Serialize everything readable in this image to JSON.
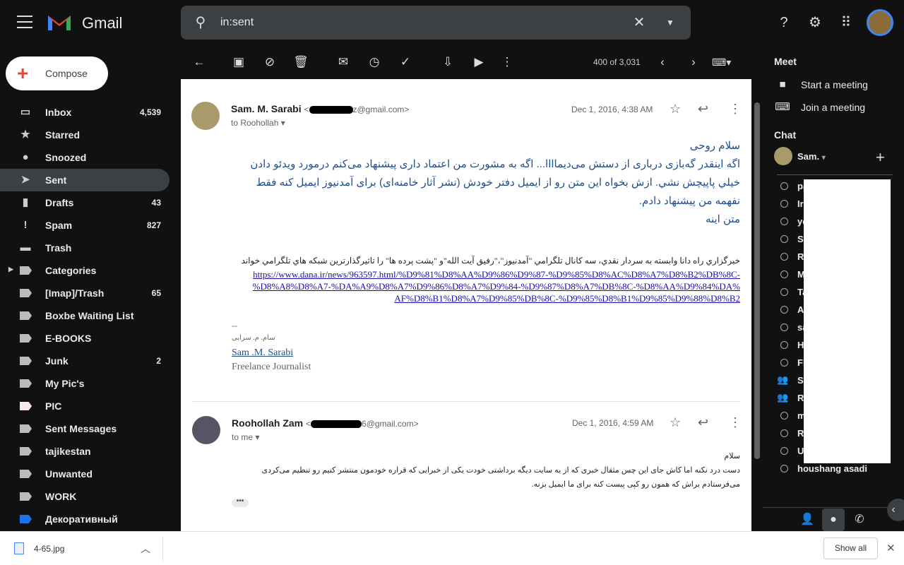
{
  "app": {
    "name": "Gmail"
  },
  "search": {
    "query": "in:sent"
  },
  "compose_label": "Compose",
  "nav": [
    {
      "label": "Inbox",
      "count": "4,539",
      "icon": "inbox-icon"
    },
    {
      "label": "Starred",
      "count": "",
      "icon": "star-icon"
    },
    {
      "label": "Snoozed",
      "count": "",
      "icon": "clock-icon"
    },
    {
      "label": "Sent",
      "count": "",
      "icon": "send-icon",
      "selected": true
    },
    {
      "label": "Drafts",
      "count": "43",
      "icon": "draft-icon"
    },
    {
      "label": "Spam",
      "count": "827",
      "icon": "spam-icon"
    },
    {
      "label": "Trash",
      "count": "",
      "icon": "trash-icon"
    },
    {
      "label": "Categories",
      "count": "",
      "icon": "label-icon"
    },
    {
      "label": "[Imap]/Trash",
      "count": "65",
      "icon": "label-icon"
    },
    {
      "label": "Boxbe Waiting List",
      "count": "",
      "icon": "label-icon"
    },
    {
      "label": "E-BOOKS",
      "count": "",
      "icon": "label-icon"
    },
    {
      "label": "Junk",
      "count": "2",
      "icon": "label-icon"
    },
    {
      "label": "My Pic's",
      "count": "",
      "icon": "label-icon"
    },
    {
      "label": "PIC",
      "count": "",
      "icon": "label-icon",
      "color": "#fce8e6"
    },
    {
      "label": "Sent Messages",
      "count": "",
      "icon": "label-icon"
    },
    {
      "label": "tajikestan",
      "count": "",
      "icon": "label-icon"
    },
    {
      "label": "Unwanted",
      "count": "",
      "icon": "label-icon"
    },
    {
      "label": "WORK",
      "count": "",
      "icon": "label-icon"
    },
    {
      "label": "Декоративный",
      "count": "",
      "icon": "label-icon",
      "color": "#1a73e8"
    }
  ],
  "toolbar": {
    "pagination": "400 of 3,031"
  },
  "messages": [
    {
      "sender": "Sam. M. Sarabi",
      "email_visible": "z@gmail.com>",
      "email_prefix": "<",
      "to": "to Roohollah",
      "date": "Dec 1, 2016, 4:38 AM",
      "body_lines": [
        "سلام روحی",
        "اگه اینقدر گه‌بازی درباری از دستش می‌دیماااا... اگه به مشورت من اعتماد داری پیشنهاد می‌کنم درمورد ویدئو دادن خیلي پاپیچش نشي. ازش بخواه این متن رو از ایمیل دفتر خودش (نشر آثار خامنه‌ای) برای آمدنیوز ایمیل کنه فقط نفهمه من پیشنهاد دادم.",
        "متن اینه"
      ],
      "news": "خبرگزاري راه دانا وابسته به سردار نقدي، سه كانال تلگرامي \"آمدنيوز\"،\"رفيق آيت الله\"و \"پشت پرده ها\" را تاثيرگذارترين شبكه هاي تلگرامي خواند",
      "link": "https://www.dana.ir/news/963597.html/%D9%81%D8%AA%D9%86%D9%87-%D9%85%D8%AC%D8%A7%D8%B2%DB%8C-%D8%A8%D8%A7-%DA%A9%D8%A7%D9%86%D8%A7%D9%84-%D9%87%D8%A7%DB%8C-%D8%AA%D9%84%DA%AF%D8%B1%D8%A7%D9%85%DB%8C-%D9%85%D8%B1%D9%85%D9%88%D8%B2",
      "sig_dash": "--",
      "sig_fa": "سام. م. سرابی",
      "sig_name": "Sam .M. Sarabi",
      "sig_title": "Freelance Journalist"
    },
    {
      "sender": "Roohollah Zam",
      "email_visible": "6@gmail.com>",
      "email_prefix": "<",
      "to": "to me",
      "date": "Dec 1, 2016, 4:59 AM",
      "body_lines": [
        "سلام",
        "دست درد نکنه اما کاش جای این چس مثقال خبری که از یه سایت دیگه برداشتی خودت یکی از خبرایی که قراره خودمون منتشر کنیم رو تنظیم می‌کردی می‌فرستادم براش که همون رو کپی پیست کنه برای ما ایمیل بزنه."
      ],
      "more": "•••"
    }
  ],
  "sidebar": {
    "meet_title": "Meet",
    "start": "Start a meeting",
    "join": "Join a meeting",
    "chat_title": "Chat",
    "me": "Sam.",
    "contacts": [
      {
        "n": "pa"
      },
      {
        "n": "Ir"
      },
      {
        "n": "yo"
      },
      {
        "n": "S"
      },
      {
        "n": "R"
      },
      {
        "n": "M"
      },
      {
        "n": "Ta"
      },
      {
        "n": "A"
      },
      {
        "n": "sa"
      },
      {
        "n": "H"
      },
      {
        "n": "Fi"
      },
      {
        "n": "S",
        "group": true
      },
      {
        "n": "R",
        "group": true
      },
      {
        "n": "m"
      },
      {
        "n": "R"
      },
      {
        "n": "U"
      },
      {
        "n": "houshang asadi"
      }
    ]
  },
  "download": {
    "file": "4-65.jpg",
    "show_all": "Show all"
  }
}
